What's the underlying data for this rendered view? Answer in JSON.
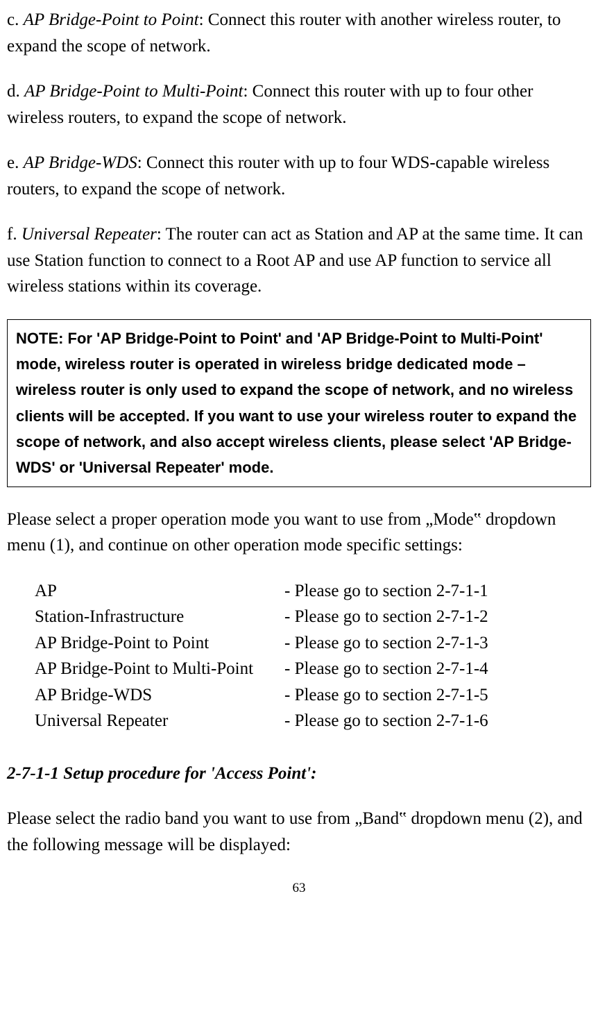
{
  "paragraphs": {
    "c_prefix": "c. ",
    "c_title": "AP Bridge-Point to Point",
    "c_body": ": Connect this router with another wireless router, to expand the scope of network.",
    "d_prefix": "d. ",
    "d_title": "AP Bridge-Point to Multi-Point",
    "d_body": ": Connect this router with up to four other wireless routers, to expand the scope of network.",
    "e_prefix": "e. ",
    "e_title": "AP Bridge-WDS",
    "e_body": ": Connect this router with up to four WDS-capable wireless routers, to expand the scope of network.",
    "f_prefix": "f. ",
    "f_title": "Universal Repeater",
    "f_body": ": The router can act as Station and AP at the same time. It can use Station function to connect to a Root AP and use AP function to service all wireless stations within its coverage."
  },
  "note": "NOTE: For 'AP Bridge-Point to Point' and 'AP Bridge-Point to Multi-Point' mode, wireless router is operated in wireless bridge dedicated mode – wireless router is only used to expand the scope of network, and no wireless clients will be accepted. If you want to use your wireless router to expand the scope of network, and also accept wireless clients, please select 'AP Bridge-WDS' or 'Universal Repeater' mode.",
  "select_text": "Please select a proper operation mode you want to use from „Mode‟ dropdown menu (1), and continue on other operation mode specific settings:",
  "modes": [
    {
      "name": "AP",
      "ref": "- Please go to section 2-7-1-1"
    },
    {
      "name": "Station-Infrastructure",
      "ref": "- Please go to section 2-7-1-2"
    },
    {
      "name": "AP Bridge-Point to Point",
      "ref": "- Please go to section 2-7-1-3"
    },
    {
      "name": "AP Bridge-Point to Multi-Point",
      "ref": "- Please go to section 2-7-1-4"
    },
    {
      "name": "AP Bridge-WDS",
      "ref": "- Please go to section 2-7-1-5"
    },
    {
      "name": "Universal Repeater",
      "ref": "- Please go to section 2-7-1-6"
    }
  ],
  "section_heading": "2-7-1-1 Setup procedure for 'Access Point':",
  "band_text": "Please select the radio band you want to use from „Band‟ dropdown menu (2), and the following message will be displayed:",
  "page_number": "63"
}
